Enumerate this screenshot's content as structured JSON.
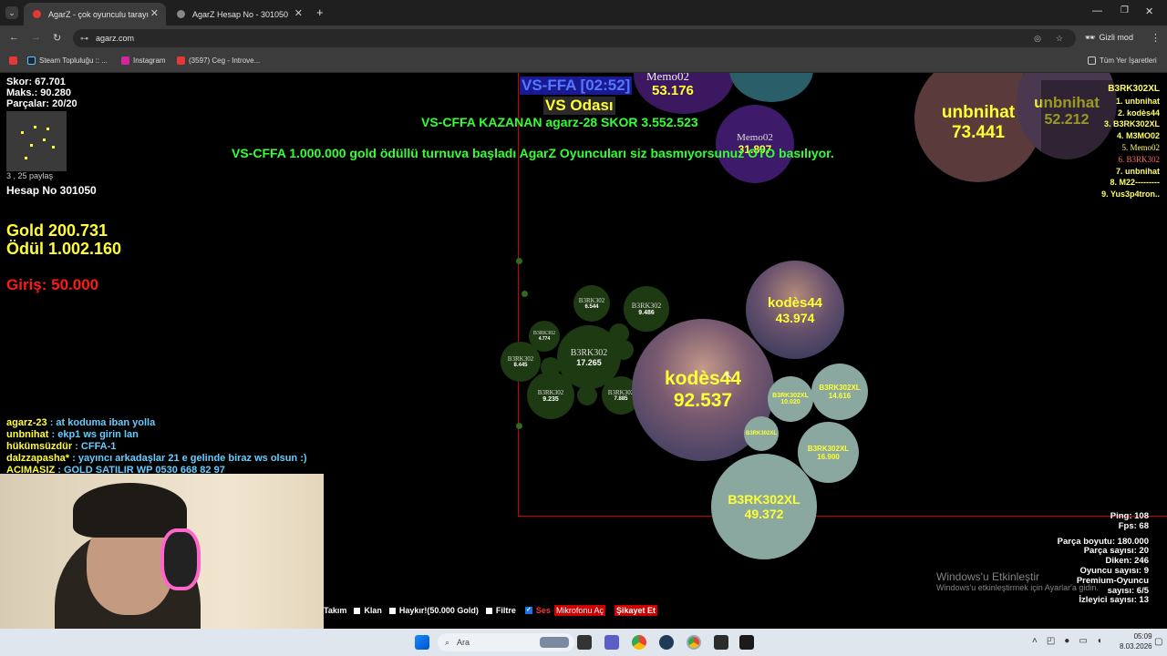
{
  "browser": {
    "tabs": [
      {
        "title": "AgarZ - çok oyunculu tarayıcı o",
        "active": true
      },
      {
        "title": "AgarZ Hesap No - 301050",
        "active": false
      }
    ],
    "url": "agarz.com",
    "incognito_label": "Gizli mod",
    "bookmarks": [
      "Steam Topluluğu :: ...",
      "Instagram",
      "(3597) Ceg - Introve..."
    ],
    "all_bookmarks_label": "Tüm Yer İşaretleri"
  },
  "stats": {
    "score": "Skor: 67.701",
    "max": "Maks.: 90.280",
    "pieces": "Parçalar: 20/20",
    "shares": "3 , 25 paylaş",
    "account": "Hesap No 301050",
    "gold": "Gold 200.731",
    "reward": "Ödül 1.002.160",
    "entry": "Giriş: 50.000"
  },
  "announcements": {
    "timer": "VS-FFA [02:52]",
    "room": "VS Odası",
    "winner": "VS-CFFA KAZANAN agarz-28 SKOR 3.552.523",
    "tournament": "VS-CFFA 1.000.000 gold ödüllü turnuva başladı AgarZ Oyuncuları siz basmıyorsunuz OTO basılıyor."
  },
  "leaderboard": [
    "B3RK302XL",
    "1. unbnihat",
    "2. kodès44",
    "3. B3RK302XL",
    "4. M3MO02",
    "5. Memo02",
    "6. B3RK302",
    "7. unbnihat",
    "8. M22---------",
    "9. Yus3p4tron.."
  ],
  "chat": [
    {
      "user": "agarz-23",
      "msg": " : at koduma iban yolla"
    },
    {
      "user": "unbnihat",
      "msg": " : ekp1 ws girin lan"
    },
    {
      "user": "hükümsüzdür",
      "msg": " : CFFA-1"
    },
    {
      "user": "dalzzapasha*",
      "msg": " : yayıncı arkadaşlar 21 e gelinde biraz ws olsun :)"
    },
    {
      "user": "ACIMASIZ",
      "msg": " : GOLD SATILIR WP 0530 668 82 97"
    }
  ],
  "cells": {
    "kodes_big": {
      "name": "kodès44",
      "mass": "92.537"
    },
    "kodes_small": {
      "name": "kodès44",
      "mass": "43.974"
    },
    "unbnihat": {
      "name": "unbnihat",
      "mass": "73.441"
    },
    "unbnihat2": {
      "name": "unbnihat",
      "mass": "52.212"
    },
    "memo_top": {
      "name": "Memo02",
      "mass": "53.176"
    },
    "memo_mid": {
      "name": "Memo02",
      "mass": "31.897"
    },
    "b3rk_big": {
      "name": "B3RK302XL",
      "mass": "49.372"
    },
    "b3rk_16900": {
      "name": "B3RK302XL",
      "mass": "16.900"
    },
    "b3rk_14616": {
      "name": "B3RK302XL",
      "mass": "14.616"
    },
    "b3rk_10020": {
      "name": "B3RK302XL",
      "mass": "10.020"
    },
    "b3rk_xl_small": {
      "name": "B3RK302XL",
      "mass": ""
    },
    "b_17265": {
      "name": "B3RK302",
      "mass": "17.265"
    },
    "b_9486": {
      "name": "B3RK302",
      "mass": "9.486"
    },
    "b_8445": {
      "name": "B3RK302",
      "mass": "8.445"
    },
    "b_9235": {
      "name": "B3RK302",
      "mass": "9.235"
    },
    "b_7885": {
      "name": "B3RK302",
      "mass": "7.885"
    },
    "b_6544": {
      "name": "B3RK302",
      "mass": "6.544"
    },
    "b_4774": {
      "name": "B3RK302",
      "mass": "4.774"
    }
  },
  "server_stats": {
    "ping": "Ping: 108",
    "fps": "Fps: 68",
    "piece_size": "Parça boyutu: 180.000",
    "piece_count": "Parça sayısı: 20",
    "spikes": "Diken: 246",
    "players": "Oyuncu sayısı: 9",
    "premium": "Premium-Oyuncu sayısı: 6/5",
    "viewers": "İzleyici sayısı: 13"
  },
  "watermark": {
    "line1": "Windows'u Etkinleştir",
    "line2": "Windows'u etkinleştirmek için Ayarlar'a gidin."
  },
  "bottom_controls": {
    "team": "Takım",
    "clan": "Klan",
    "shout": "Haykır!(50.000 Gold)",
    "filter": "Filtre",
    "sound": "Ses",
    "mic": "Mikrofonu Aç",
    "complaint": "Şikayet Et"
  },
  "taskbar": {
    "search_placeholder": "Ara",
    "time": "05:09",
    "date": "8.03.2026"
  },
  "colors": {
    "yellow_text": "#ffff33",
    "green_text": "#33ff33",
    "red_text": "#ff1a1a",
    "border": "#cc0000",
    "b3rk_cell": "#8aa8a0",
    "green_cell": "#1d3a12"
  }
}
